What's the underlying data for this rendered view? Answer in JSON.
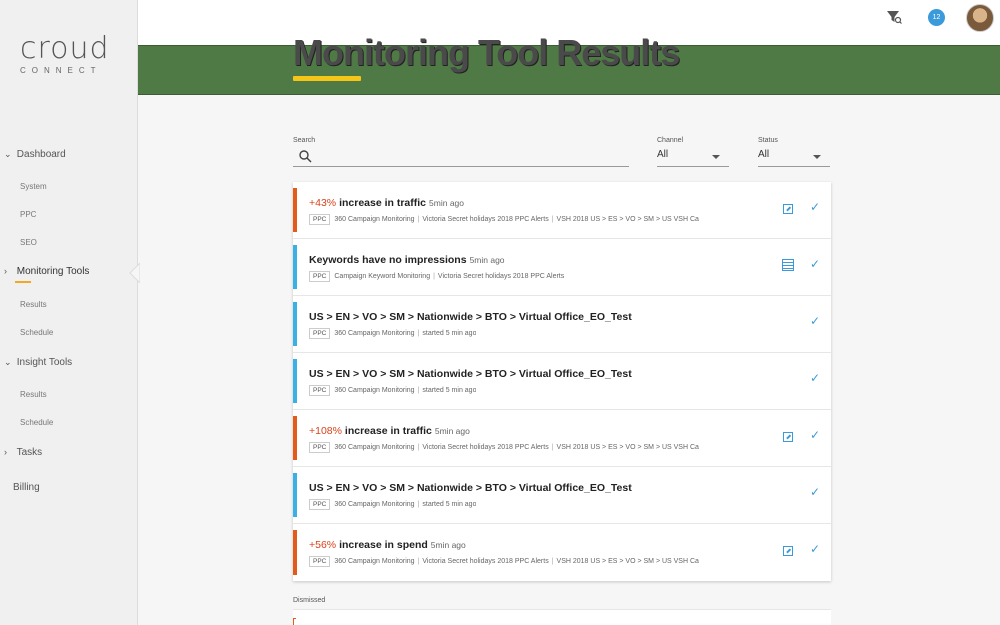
{
  "sidebar": {
    "logo_word": "croud",
    "logo_sub": "CONNECT",
    "items": [
      {
        "label": "Dashboard",
        "chevron": "v"
      },
      {
        "label": "System"
      },
      {
        "label": "PPC"
      },
      {
        "label": "SEO"
      },
      {
        "label": "Monitoring Tools",
        "chevron": ">"
      },
      {
        "label": "Results"
      },
      {
        "label": "Schedule"
      },
      {
        "label": "Insight Tools",
        "chevron": "v"
      },
      {
        "label": "Results"
      },
      {
        "label": "Schedule"
      },
      {
        "label": "Tasks",
        "chevron": ">"
      },
      {
        "label": "Billing"
      }
    ]
  },
  "header": {
    "notification_count": "12",
    "filter_icon": "filter-search-icon",
    "title": "Monitoring Tool Results"
  },
  "filters": {
    "search_label": "Search",
    "search_placeholder": "",
    "channel_label": "Channel",
    "channel_value": "All",
    "status_label": "Status",
    "status_value": "All"
  },
  "cards": [
    {
      "pct": "+43%",
      "title": " increase in traffic",
      "time": "5min ago",
      "tag": "PPC",
      "meta1": "360 Campaign Monitoring",
      "meta2": "Victoria Secret holidays 2018 PPC Alerts",
      "meta3": "VSH 2018 US > ES > VO > SM > US VSH Ca"
    },
    {
      "pct": "",
      "title": "Keywords have no impressions",
      "time": "5min ago",
      "tag": "PPC",
      "meta1": "Campaign Keyword Monitoring",
      "meta2": "Victoria Secret holidays 2018 PPC Alerts",
      "meta3": ""
    },
    {
      "pct": "",
      "title": "US > EN > VO > SM > Nationwide > BTO > Virtual Office_EO_Test",
      "time": "",
      "tag": "PPC",
      "meta1": "360 Campaign Monitoring",
      "meta2": "started 5 min ago",
      "meta3": ""
    },
    {
      "pct": "",
      "title": "US > EN > VO > SM > Nationwide > BTO > Virtual Office_EO_Test",
      "time": "",
      "tag": "PPC",
      "meta1": "360 Campaign Monitoring",
      "meta2": "started 5 min ago",
      "meta3": ""
    },
    {
      "pct": "+108%",
      "title": " increase in traffic",
      "time": "5min ago",
      "tag": "PPC",
      "meta1": "360 Campaign Monitoring",
      "meta2": "Victoria Secret holidays 2018 PPC Alerts",
      "meta3": "VSH 2018 US > ES > VO > SM > US VSH Ca"
    },
    {
      "pct": "",
      "title": "US > EN > VO > SM > Nationwide > BTO > Virtual Office_EO_Test",
      "time": "",
      "tag": "PPC",
      "meta1": "360 Campaign Monitoring",
      "meta2": "started 5 min ago",
      "meta3": ""
    },
    {
      "pct": "+56%",
      "title": " increase in spend",
      "time": "5min ago",
      "tag": "PPC",
      "meta1": "360 Campaign Monitoring",
      "meta2": "Victoria Secret holidays 2018 PPC Alerts",
      "meta3": "VSH 2018 US > ES > VO > SM > US VSH Ca"
    }
  ],
  "dismissed_label": "Dismissed",
  "colors": {
    "accent": "#3b9ad9",
    "alert": "#e45a1b",
    "info": "#3bb0e6",
    "highlight": "#f5c518",
    "banner": "#4f7a46"
  }
}
